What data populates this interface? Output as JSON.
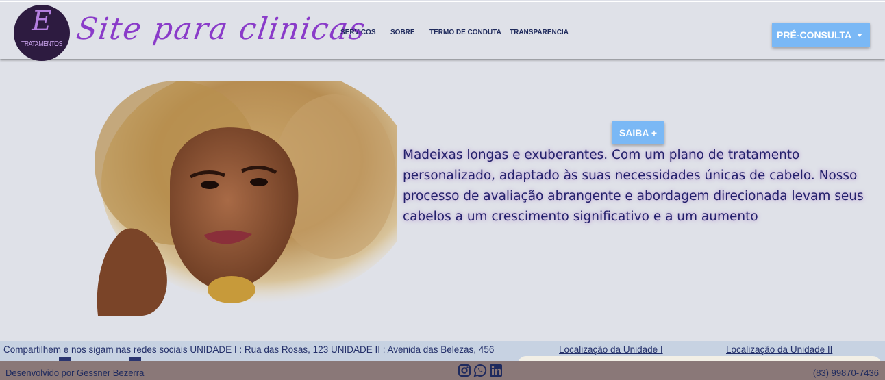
{
  "header": {
    "logo_monogram": "E",
    "logo_text": "TRATAMENTOS",
    "brand": "Site para clinicas",
    "nav": [
      "SERVICOS",
      "SOBRE",
      "TERMO DE CONDUTA",
      "TRANSPARENCIA"
    ],
    "pre_consulta": "PRÉ-CONSULTA"
  },
  "hero": {
    "saiba_label": "SAIBA +",
    "text": "Madeixas longas e exuberantes. Com um plano de tratamento personalizado, adaptado às suas necessidades únicas de cabelo. Nosso processo de avaliação abrangente e abordagem direcionada levam seus cabelos a um crescimento significativo e a um aumento"
  },
  "footer": {
    "info": "Compartilhem e nos sigam nas redes sociais UNIDADE I : Rua das Rosas, 123 UNIDADE II : Avenida das Belezas, 456",
    "loc1": "Localização da Unidade I",
    "loc2": "Localização da Unidade II"
  },
  "bottom": {
    "developer": "Desenvolvido por Gessner Bezerra",
    "phone": "(83) 99870-7436",
    "socials": [
      "instagram-icon",
      "whatsapp-icon",
      "linkedin-icon"
    ]
  },
  "colors": {
    "accent": "#7ab8f5",
    "brand": "#8a3bc9",
    "text": "#23206b",
    "bottom_bar": "#8a7878"
  }
}
